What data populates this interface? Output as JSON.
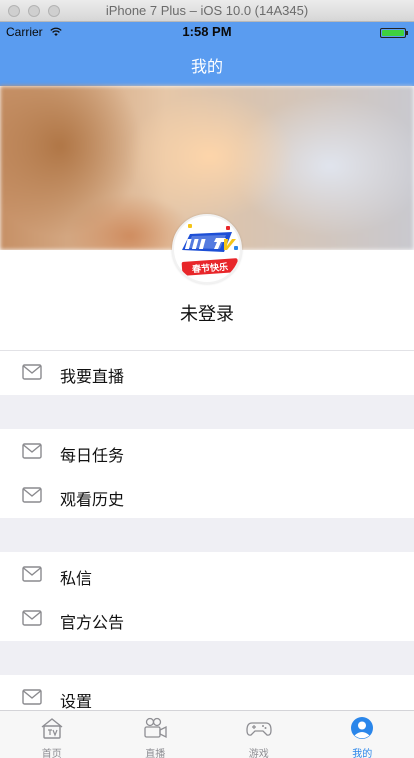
{
  "window": {
    "title": "iPhone 7 Plus – iOS 10.0 (14A345)"
  },
  "status_bar": {
    "carrier": "Carrier",
    "time": "1:58 PM"
  },
  "nav": {
    "title": "我的"
  },
  "profile": {
    "avatar_ribbon": "春节快乐",
    "login_status": "未登录"
  },
  "menu": {
    "group1": [
      {
        "label": "我要直播",
        "icon": "mail-icon"
      }
    ],
    "group2": [
      {
        "label": "每日任务",
        "icon": "mail-icon"
      },
      {
        "label": "观看历史",
        "icon": "mail-icon"
      }
    ],
    "group3": [
      {
        "label": "私信",
        "icon": "mail-icon"
      },
      {
        "label": "官方公告",
        "icon": "mail-icon"
      }
    ],
    "group4": [
      {
        "label": "设置",
        "icon": "mail-icon"
      }
    ]
  },
  "tabbar": {
    "items": [
      {
        "label": "首页",
        "icon": "tv-home-icon"
      },
      {
        "label": "直播",
        "icon": "camera-icon"
      },
      {
        "label": "游戏",
        "icon": "gamepad-icon"
      },
      {
        "label": "我的",
        "icon": "user-icon"
      }
    ],
    "active_index": 3
  },
  "colors": {
    "accent": "#5a9cf0",
    "tab_active": "#2a86ea",
    "group_gap": "#efeff4"
  }
}
